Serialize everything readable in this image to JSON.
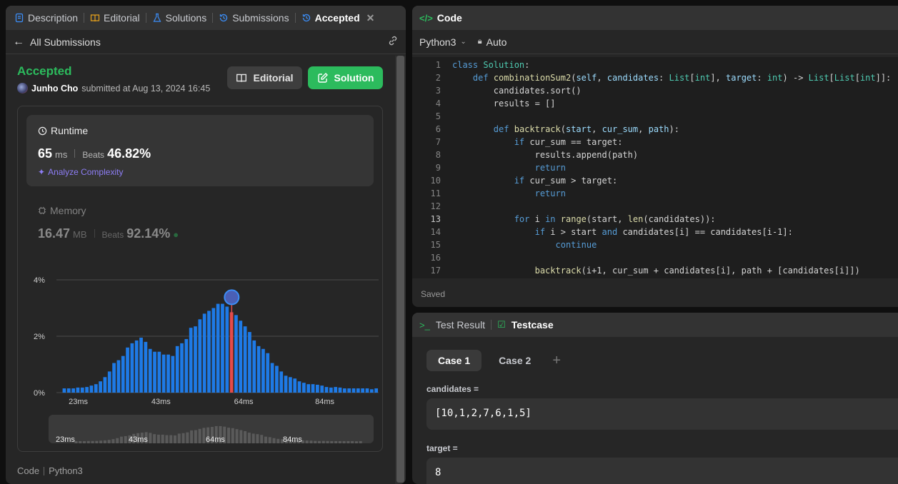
{
  "tabs": [
    {
      "label": "Description"
    },
    {
      "label": "Editorial"
    },
    {
      "label": "Solutions"
    },
    {
      "label": "Submissions"
    },
    {
      "label": "Accepted"
    }
  ],
  "back_label": "All Submissions",
  "status": "Accepted",
  "submitter": {
    "name": "Junho Cho",
    "text": "submitted at Aug 13, 2024 16:45"
  },
  "buttons": {
    "editorial": "Editorial",
    "solution": "Solution"
  },
  "runtime": {
    "label": "Runtime",
    "value": "65",
    "unit": "ms",
    "beats_label": "Beats",
    "beats": "46.82%",
    "analyze": "Analyze Complexity"
  },
  "memory": {
    "label": "Memory",
    "value": "16.47",
    "unit": "MB",
    "beats_label": "Beats",
    "beats": "92.14%"
  },
  "chart_data": {
    "type": "bar",
    "y_ticks": [
      "4%",
      "2%",
      "0%"
    ],
    "x_ticks": [
      "23ms",
      "43ms",
      "64ms",
      "84ms"
    ],
    "ylim": [
      0,
      4
    ],
    "values": [
      0.15,
      0.15,
      0.15,
      0.18,
      0.18,
      0.2,
      0.25,
      0.3,
      0.4,
      0.55,
      0.75,
      1.05,
      1.15,
      1.3,
      1.6,
      1.75,
      1.85,
      1.95,
      1.8,
      1.55,
      1.45,
      1.45,
      1.35,
      1.35,
      1.3,
      1.65,
      1.75,
      1.9,
      2.3,
      2.35,
      2.6,
      2.8,
      2.9,
      3.0,
      3.15,
      3.15,
      3.05,
      2.85,
      2.75,
      2.55,
      2.35,
      2.15,
      1.85,
      1.65,
      1.55,
      1.4,
      1.05,
      0.95,
      0.75,
      0.6,
      0.55,
      0.5,
      0.4,
      0.35,
      0.3,
      0.3,
      0.28,
      0.25,
      0.2,
      0.18,
      0.2,
      0.18,
      0.15,
      0.15,
      0.15,
      0.15,
      0.15,
      0.15,
      0.12,
      0.15
    ],
    "highlight_index": 37
  },
  "footer": {
    "code_label": "Code",
    "lang": "Python3"
  },
  "code_panel": {
    "title": "Code",
    "language": "Python3",
    "mode": "Auto",
    "saved": "Saved"
  },
  "code_lines": [
    "class Solution:",
    "    def combinationSum2(self, candidates: List[int], target: int) -> List[List[int]]:",
    "        candidates.sort()",
    "        results = []",
    "",
    "        def backtrack(start, cur_sum, path):",
    "            if cur_sum == target:",
    "                results.append(path)",
    "                return",
    "            if cur_sum > target:",
    "                return",
    "",
    "            for i in range(start, len(candidates)):",
    "                if i > start and candidates[i] == candidates[i-1]:",
    "                    continue",
    "",
    "                backtrack(i+1, cur_sum + candidates[i], path + [candidates[i]])"
  ],
  "test_panel": {
    "tab_result": "Test Result",
    "tab_testcase": "Testcase",
    "cases": [
      "Case 1",
      "Case 2"
    ],
    "fields": [
      {
        "label": "candidates =",
        "value": "[10,1,2,7,6,1,5]"
      },
      {
        "label": "target =",
        "value": "8"
      }
    ]
  },
  "colors": {
    "accent_green": "#2cbb5d",
    "bar_blue": "#1e7ae6",
    "purple": "#8d7df5"
  }
}
